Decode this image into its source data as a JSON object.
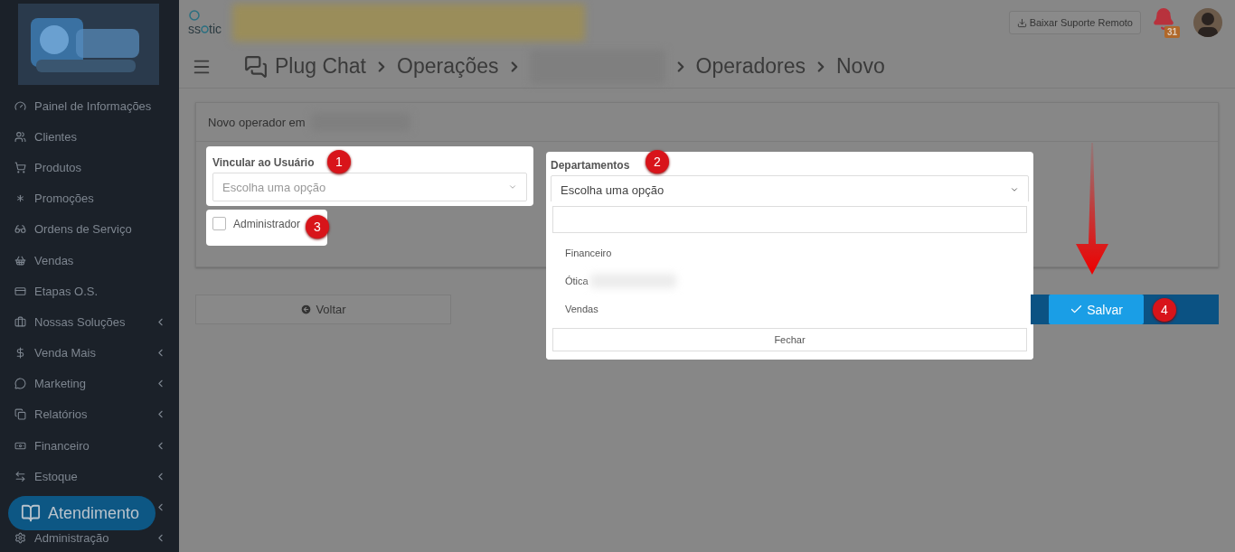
{
  "sidebar": {
    "items": [
      {
        "label": "Painel de Informações",
        "expandable": false
      },
      {
        "label": "Clientes",
        "expandable": false
      },
      {
        "label": "Produtos",
        "expandable": false
      },
      {
        "label": "Promoções",
        "expandable": false
      },
      {
        "label": "Ordens de Serviço",
        "expandable": false
      },
      {
        "label": "Vendas",
        "expandable": false
      },
      {
        "label": "Etapas O.S.",
        "expandable": false
      },
      {
        "label": "Nossas Soluções",
        "expandable": true
      },
      {
        "label": "Venda Mais",
        "expandable": true
      },
      {
        "label": "Marketing",
        "expandable": true
      },
      {
        "label": "Relatórios",
        "expandable": true
      },
      {
        "label": "Financeiro",
        "expandable": true
      },
      {
        "label": "Estoque",
        "expandable": true
      },
      {
        "expandable": true
      },
      {
        "label": "Administração",
        "expandable": true
      }
    ],
    "help_button": {
      "label": "Atendimento"
    }
  },
  "topbar": {
    "logo": {
      "prefix": "ss",
      "suffix": "tic"
    },
    "support_button": "Baixar Suporte Remoto",
    "notifications": "31"
  },
  "breadcrumb": [
    "Plug Chat",
    "Operações",
    "Operadores",
    "Novo"
  ],
  "panel": {
    "title": "Novo operador em",
    "user_field": {
      "label": "Vincular ao Usuário",
      "placeholder": "Escolha uma opção",
      "step": "1"
    },
    "admin_checkbox": {
      "label": "Administrador",
      "checked": false,
      "step": "3"
    },
    "departments": {
      "label": "Departamentos",
      "value": "Escolha uma opção",
      "step": "2",
      "expanded": true,
      "options": [
        "Financeiro",
        "Ótica",
        "Vendas"
      ],
      "close": "Fechar"
    }
  },
  "actions": {
    "back": "Voltar",
    "save": "Salvar",
    "save_step": "4"
  }
}
